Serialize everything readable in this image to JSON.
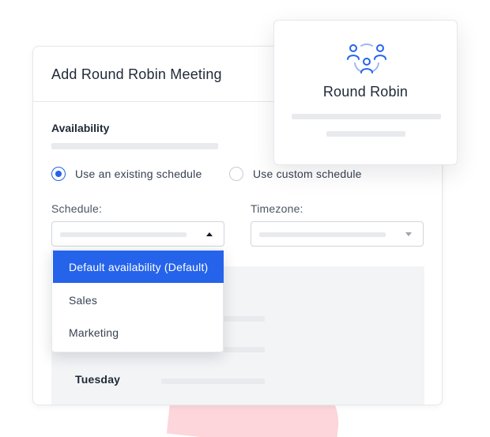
{
  "dialog": {
    "title": "Add Round Robin Meeting",
    "availability_heading": "Availability",
    "schedule_options": [
      {
        "label": "Use an existing schedule",
        "checked": true
      },
      {
        "label": "Use custom schedule",
        "checked": false
      }
    ],
    "schedule_label": "Schedule:",
    "timezone_label": "Timezone:",
    "schedule_dropdown": {
      "open": true,
      "options": [
        {
          "label": "Default availability (Default)",
          "selected": true
        },
        {
          "label": "Sales",
          "selected": false
        },
        {
          "label": "Marketing",
          "selected": false
        }
      ]
    },
    "weekday_visible": "Tuesday"
  },
  "round_robin_card": {
    "title": "Round Robin",
    "icon": "round-robin-users-icon"
  },
  "colors": {
    "accent": "#2563eb",
    "placeholder_bar": "#e8eaed",
    "panel_bg": "#f3f4f6",
    "decor_pink": "#fcd6da"
  }
}
